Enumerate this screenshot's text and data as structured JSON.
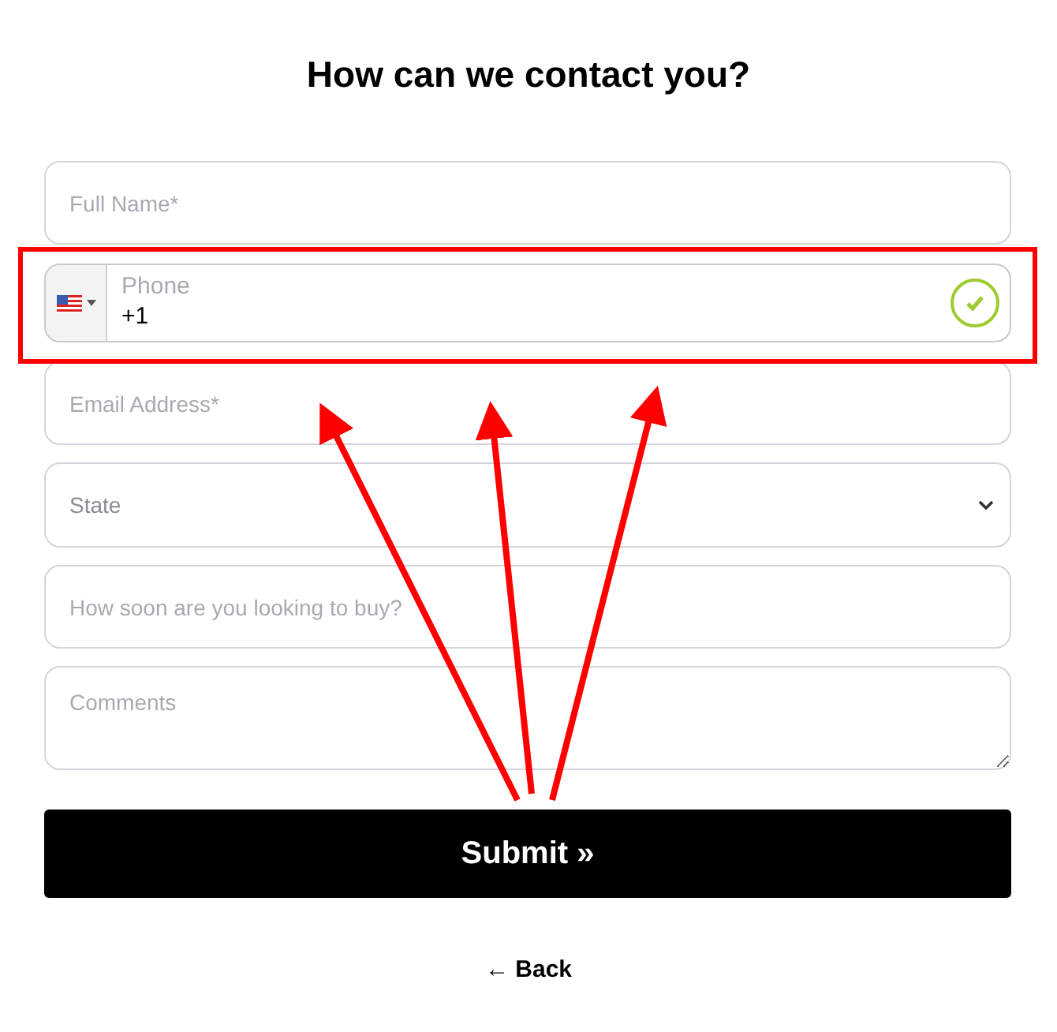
{
  "title": "How can we contact you?",
  "fields": [
    {
      "kind": "text",
      "placeholder": "Full Name*"
    },
    {
      "kind": "phone",
      "label": "Phone",
      "value": "+1",
      "valid": true
    },
    {
      "kind": "text",
      "placeholder": "Email Address*"
    },
    {
      "kind": "select",
      "placeholder": "State"
    },
    {
      "kind": "text",
      "placeholder": "How soon are you looking to buy?"
    },
    {
      "kind": "textarea",
      "placeholder": "Comments"
    }
  ],
  "submit": "Submit »",
  "back": "← Back"
}
